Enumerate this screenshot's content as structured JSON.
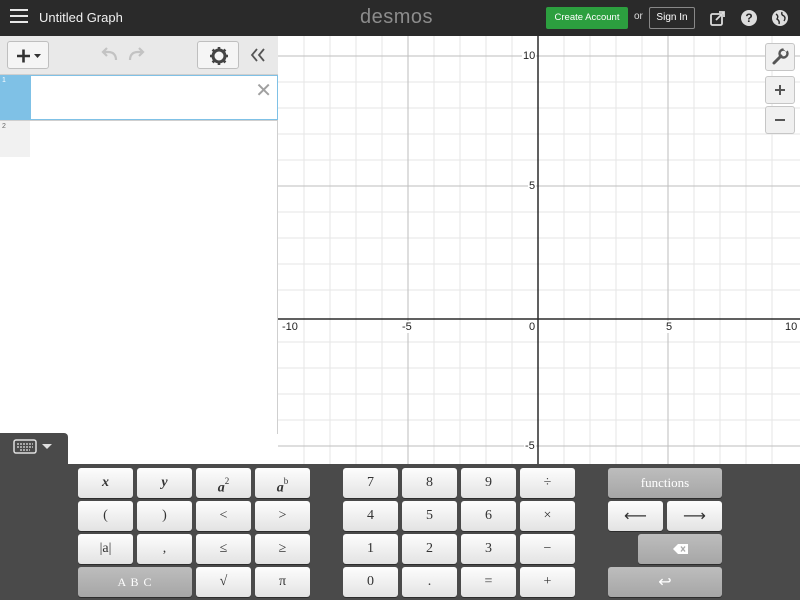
{
  "topbar": {
    "title": "Untitled Graph",
    "brand": "desmos",
    "create_account": "Create Account",
    "or": "or",
    "sign_in": "Sign In"
  },
  "expressions": [
    {
      "index": "1",
      "value": ""
    },
    {
      "index": "2",
      "value": ""
    }
  ],
  "graph": {
    "x_ticks": [
      "-10",
      "-5",
      "0",
      "5",
      "10"
    ],
    "y_ticks": [
      "10",
      "5",
      "-5"
    ]
  },
  "keypad": {
    "letters": [
      "x",
      "y",
      "a",
      "a",
      "(",
      ")",
      "<",
      ">",
      "|a|",
      ",",
      "≤",
      "≥",
      "A B C",
      "√",
      "π"
    ],
    "squared_exp": "2",
    "power_exp": "b",
    "numbers": [
      "7",
      "8",
      "9",
      "÷",
      "4",
      "5",
      "6",
      "×",
      "1",
      "2",
      "3",
      "−",
      "0",
      ".",
      "=",
      "+"
    ],
    "functions": "functions",
    "left_arrow": "⟵",
    "right_arrow": "⟶",
    "enter": "↩"
  },
  "colors": {
    "topbar": "#2a2a2a",
    "create_account": "#2c9f3f",
    "active_row": "#7fc1e6",
    "keypad_bg": "#4a4a4a"
  }
}
